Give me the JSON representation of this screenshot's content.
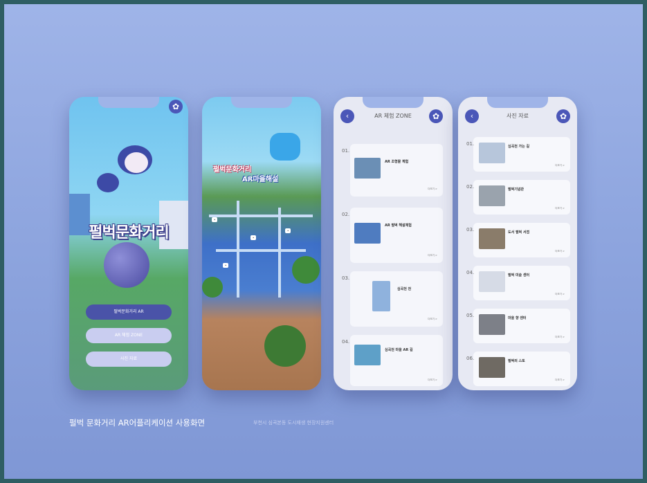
{
  "phone1": {
    "logo": "펄벅문화거리",
    "buttons": [
      "펄벅문화거리 AR",
      "AR 체험 ZONE",
      "사진 자료"
    ]
  },
  "phone2": {
    "title_line1": "펄벅문화거리",
    "title_line2": "AR마을해설"
  },
  "phone3": {
    "title": "AR 체험 ZONE",
    "items": [
      {
        "num": "01.",
        "title": "AR 조형물 체험",
        "more": "더보기 >"
      },
      {
        "num": "02.",
        "title": "AR 펄벅 해설체험",
        "more": "더보기 >"
      },
      {
        "num": "03.",
        "title": "심곡천 천",
        "more": "더보기 >"
      },
      {
        "num": "04.",
        "title": "심곡천 마을 AR 길",
        "more": "더보기 >"
      }
    ]
  },
  "phone4": {
    "title": "사진 자료",
    "items": [
      {
        "num": "01.",
        "title": "심곡천 가는 길",
        "more": "더보기 >"
      },
      {
        "num": "02.",
        "title": "펄벅기념관",
        "more": "더보기 >"
      },
      {
        "num": "03.",
        "title": "도서 펄벅 서점",
        "more": "더보기 >"
      },
      {
        "num": "04.",
        "title": "펄벅 미술 센터",
        "more": "더보기 >"
      },
      {
        "num": "05.",
        "title": "마을 향 센터",
        "more": "더보기 >"
      },
      {
        "num": "06.",
        "title": "펄벅의 스토",
        "more": "더보기 >"
      }
    ]
  },
  "caption": "펄벅 문화거리 AR어플리케이션 사용화면",
  "subcaption": "부천시 심곡본동 도시재생 현장지원센터",
  "colors": {
    "accent": "#4b57b8",
    "background": "#9fb4e8"
  }
}
